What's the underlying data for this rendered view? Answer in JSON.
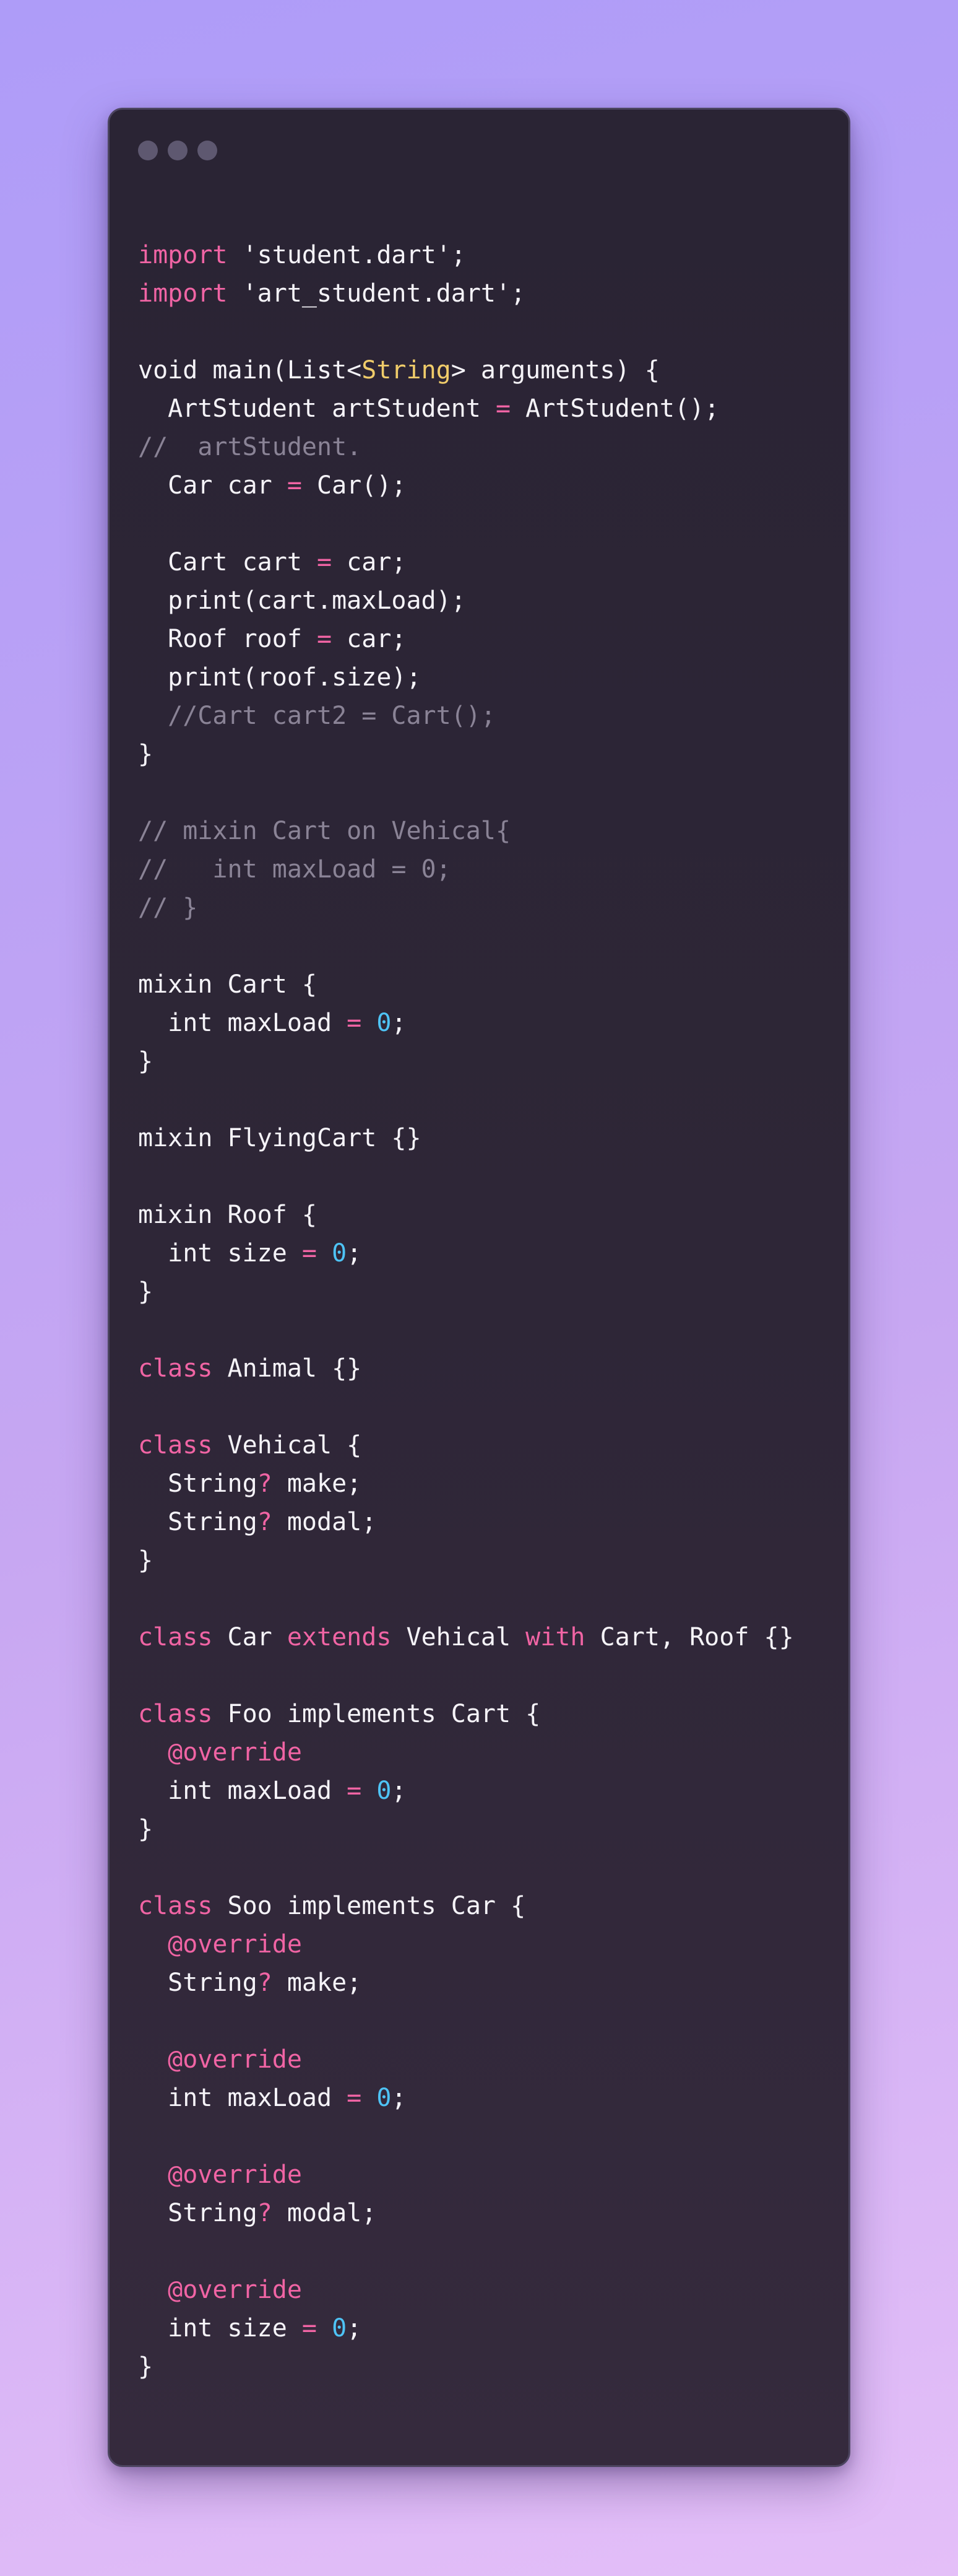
{
  "window": {
    "title_dots": [
      "close-dot",
      "minimize-dot",
      "maximize-dot"
    ]
  },
  "colors": {
    "background_top": "#ae9cf8",
    "background_bottom": "#e4bff8",
    "window_bg": "#2e2637",
    "plain": "#f5f3f8",
    "keyword": "#f064a4",
    "type": "#f0cc6a",
    "number": "#4ec3f5",
    "comment": "#8a8396"
  },
  "code": {
    "language": "dart",
    "lines": [
      [
        [
          "kw",
          "import"
        ],
        [
          "plain",
          " 'student.dart';"
        ]
      ],
      [
        [
          "kw",
          "import"
        ],
        [
          "plain",
          " 'art_student.dart';"
        ]
      ],
      [],
      [
        [
          "plain",
          "void main(List<"
        ],
        [
          "type",
          "String"
        ],
        [
          "plain",
          "> arguments) {"
        ]
      ],
      [
        [
          "plain",
          "  ArtStudent artStudent "
        ],
        [
          "kw",
          "="
        ],
        [
          "plain",
          " ArtStudent();"
        ]
      ],
      [
        [
          "comment",
          "//  artStudent."
        ]
      ],
      [
        [
          "plain",
          "  Car car "
        ],
        [
          "kw",
          "="
        ],
        [
          "plain",
          " Car();"
        ]
      ],
      [],
      [
        [
          "plain",
          "  Cart cart "
        ],
        [
          "kw",
          "="
        ],
        [
          "plain",
          " car;"
        ]
      ],
      [
        [
          "plain",
          "  print(cart.maxLoad);"
        ]
      ],
      [
        [
          "plain",
          "  Roof roof "
        ],
        [
          "kw",
          "="
        ],
        [
          "plain",
          " car;"
        ]
      ],
      [
        [
          "plain",
          "  print(roof.size);"
        ]
      ],
      [
        [
          "comment",
          "  //Cart cart2 = Cart();"
        ]
      ],
      [
        [
          "plain",
          "}"
        ]
      ],
      [],
      [
        [
          "comment",
          "// mixin Cart on Vehical{"
        ]
      ],
      [
        [
          "comment",
          "//   int maxLoad = 0;"
        ]
      ],
      [
        [
          "comment",
          "// }"
        ]
      ],
      [],
      [
        [
          "plain",
          "mixin Cart {"
        ]
      ],
      [
        [
          "plain",
          "  int maxLoad "
        ],
        [
          "kw",
          "="
        ],
        [
          "plain",
          " "
        ],
        [
          "num",
          "0"
        ],
        [
          "plain",
          ";"
        ]
      ],
      [
        [
          "plain",
          "}"
        ]
      ],
      [],
      [
        [
          "plain",
          "mixin FlyingCart {}"
        ]
      ],
      [],
      [
        [
          "plain",
          "mixin Roof {"
        ]
      ],
      [
        [
          "plain",
          "  int size "
        ],
        [
          "kw",
          "="
        ],
        [
          "plain",
          " "
        ],
        [
          "num",
          "0"
        ],
        [
          "plain",
          ";"
        ]
      ],
      [
        [
          "plain",
          "}"
        ]
      ],
      [],
      [
        [
          "kw",
          "class"
        ],
        [
          "plain",
          " Animal {}"
        ]
      ],
      [],
      [
        [
          "kw",
          "class"
        ],
        [
          "plain",
          " Vehical {"
        ]
      ],
      [
        [
          "plain",
          "  String"
        ],
        [
          "kw",
          "?"
        ],
        [
          "plain",
          " make;"
        ]
      ],
      [
        [
          "plain",
          "  String"
        ],
        [
          "kw",
          "?"
        ],
        [
          "plain",
          " modal;"
        ]
      ],
      [
        [
          "plain",
          "}"
        ]
      ],
      [],
      [
        [
          "kw",
          "class"
        ],
        [
          "plain",
          " Car "
        ],
        [
          "kw",
          "extends"
        ],
        [
          "plain",
          " Vehical "
        ],
        [
          "kw",
          "with"
        ],
        [
          "plain",
          " Cart, Roof {}"
        ]
      ],
      [],
      [
        [
          "kw",
          "class"
        ],
        [
          "plain",
          " Foo implements Cart {"
        ]
      ],
      [
        [
          "kw",
          "  @override"
        ]
      ],
      [
        [
          "plain",
          "  int maxLoad "
        ],
        [
          "kw",
          "="
        ],
        [
          "plain",
          " "
        ],
        [
          "num",
          "0"
        ],
        [
          "plain",
          ";"
        ]
      ],
      [
        [
          "plain",
          "}"
        ]
      ],
      [],
      [
        [
          "kw",
          "class"
        ],
        [
          "plain",
          " Soo implements Car {"
        ]
      ],
      [
        [
          "kw",
          "  @override"
        ]
      ],
      [
        [
          "plain",
          "  String"
        ],
        [
          "kw",
          "?"
        ],
        [
          "plain",
          " make;"
        ]
      ],
      [],
      [
        [
          "kw",
          "  @override"
        ]
      ],
      [
        [
          "plain",
          "  int maxLoad "
        ],
        [
          "kw",
          "="
        ],
        [
          "plain",
          " "
        ],
        [
          "num",
          "0"
        ],
        [
          "plain",
          ";"
        ]
      ],
      [],
      [
        [
          "kw",
          "  @override"
        ]
      ],
      [
        [
          "plain",
          "  String"
        ],
        [
          "kw",
          "?"
        ],
        [
          "plain",
          " modal;"
        ]
      ],
      [],
      [
        [
          "kw",
          "  @override"
        ]
      ],
      [
        [
          "plain",
          "  int size "
        ],
        [
          "kw",
          "="
        ],
        [
          "plain",
          " "
        ],
        [
          "num",
          "0"
        ],
        [
          "plain",
          ";"
        ]
      ],
      [
        [
          "plain",
          "}"
        ]
      ]
    ]
  }
}
